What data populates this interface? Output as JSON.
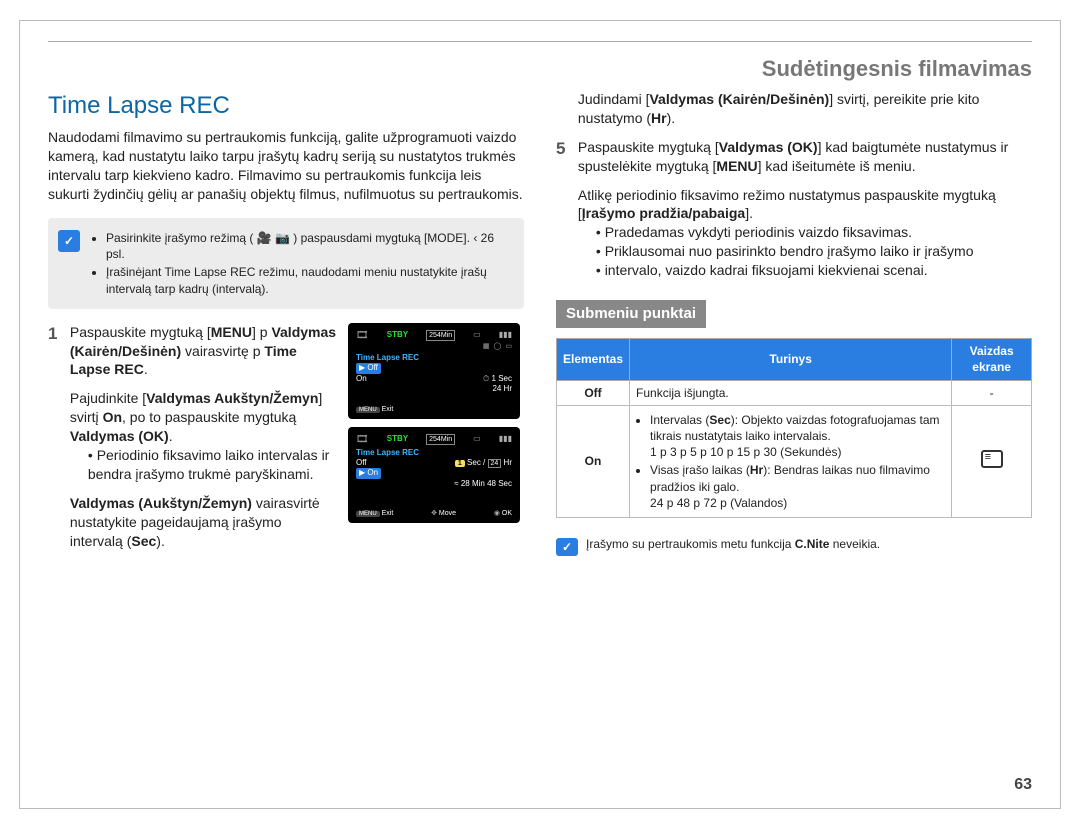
{
  "chapter": "Sudėtingesnis filmavimas",
  "title": "Time Lapse REC",
  "intro": "Naudodami filmavimo su pertraukomis funkciją, galite užprogramuoti vaizdo kamerą, kad nustatytu laiko tarpu įrašytų kadrų seriją su nustatytos trukmės intervalu tarp kiekvieno kadro. Filmavimo su pertraukomis funkcija leis sukurti žydinčių gėlių ar panašių objektų filmus, nufilmuotus su pertraukomis.",
  "notebox": {
    "icon": "✓",
    "items": [
      "Pasirinkite įrašymo režimą ( 🎥 📷 ) paspausdami mygtuką [MODE]. ‹ 26 psl.",
      "Įrašinėjant Time Lapse REC režimu, naudodami meniu nustatykite įrašų intervalą tarp kadrų (intervalą)."
    ]
  },
  "left": {
    "step1": {
      "num": "1",
      "text_before": "Paspauskite mygtuką [",
      "menu": "MENU",
      "text_mid": "]  p  ",
      "bold1": "Valdymas (Kairėn/Dešinėn)",
      "text_mid2": " vairasvirtę  p ",
      "bold2": "Time Lapse REC",
      "text_end": "."
    },
    "step2": {
      "text_before": "Pajudinkite [",
      "bold1": "Valdymas Aukštyn/Žemyn",
      "text_mid": "] svirtį ",
      "bold2": "On",
      "text_mid2": ", po to paspauskite mygtuką ",
      "bold3": "Valdymas (OK)",
      "text_end": ".",
      "sub": "Periodinio fiksavimo laiko intervalas ir bendra įrašymo trukmė paryškinami."
    },
    "step3": {
      "bold1": "Valdymas (Aukštyn/Žemyn)",
      "tail": " vairasvirtė nustatykite pageidaujamą įrašymo intervalą (",
      "bold2": "Sec",
      "end": ")."
    },
    "screen1": {
      "stby": "STBY",
      "time": "254Min",
      "title": "Time Lapse REC",
      "off": "Off",
      "on": "On",
      "sec": "1 Sec",
      "hr": "24 Hr",
      "exit": "Exit"
    },
    "screen2": {
      "stby": "STBY",
      "time": "254Min",
      "title": "Time Lapse REC",
      "off": "Off",
      "on": "On",
      "secbox": "1",
      "seclabel": "Sec /",
      "hrbox": "24",
      "hrlabel": "Hr",
      "info": "≈ 28 Min  48 Sec",
      "exit": "Exit",
      "move": "Move",
      "ok": "OK"
    }
  },
  "right": {
    "step4": {
      "text_before": "Judindami [",
      "bold1": "Valdymas (Kairėn/Dešinėn)",
      "text_mid": "] svirtį, pereikite prie kito nustatymo (",
      "bold2": "Hr",
      "text_end": ")."
    },
    "step5": {
      "num": "5",
      "t1": "Paspauskite mygtuką [",
      "b1": "Valdymas (OK)",
      "t2": "] kad baigtumėte nustatymus ir spustelėkite mygtuką [",
      "b2": "MENU",
      "t3": "] kad išeitumėte iš meniu."
    },
    "step6": {
      "t1": "Atlikę periodinio fiksavimo režimo nustatymus paspauskite mygtuką [",
      "b1": "Įrašymo pradžia/pabaiga",
      "t2": "].",
      "subs": [
        "Pradedamas vykdyti periodinis vaizdo fiksavimas.",
        "Priklausomai nuo pasirinkto bendro įrašymo laiko ir įrašymo",
        "intervalo, vaizdo kadrai fiksuojami kiekvienai scenai."
      ]
    },
    "sub_heading": "Submeniu punktai",
    "table": {
      "headers": [
        "Elementas",
        "Turinys",
        "Vaizdas ekrane"
      ],
      "rows": {
        "off": {
          "el": "Off",
          "desc": "Funkcija išjungta.",
          "disp": "-"
        },
        "on": {
          "el": "On",
          "li1_a": "Intervalas (",
          "li1_b": "Sec",
          "li1_c": "): Objekto vaizdas fotografuojamas tam tikrais nustatytais laiko intervalais.",
          "li1_d": "1  p  3  p  5  p  10  p  15  p  30 (Sekundės)",
          "li2_a": "Visas įrašo laikas (",
          "li2_b": "Hr",
          "li2_c": "): Bendras laikas nuo filmavimo pradžios iki galo.",
          "li2_d": "24  p  48  p  72  p     (Valandos)"
        }
      }
    },
    "footnote": {
      "icon": "✓",
      "t1": "Įrašymo su pertraukomis metu funkcija ",
      "b1": "C.Nite",
      "t2": " neveikia."
    }
  },
  "page_number": "63"
}
